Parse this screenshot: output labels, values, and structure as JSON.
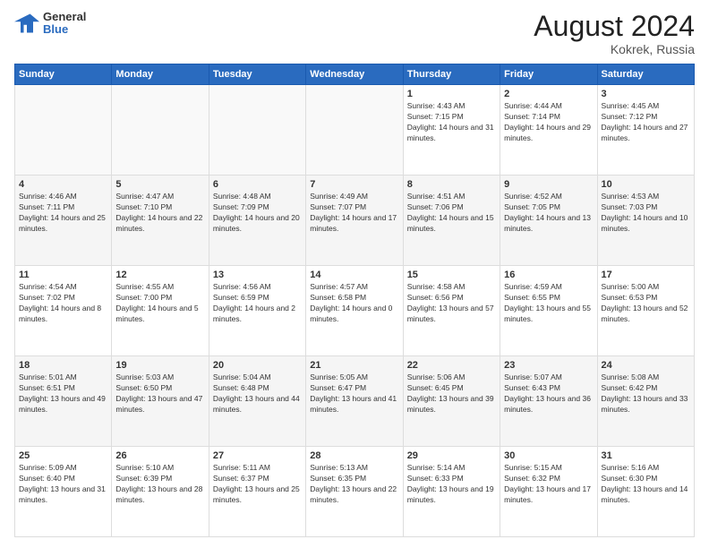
{
  "header": {
    "logo_general": "General",
    "logo_blue": "Blue",
    "main_title": "August 2024",
    "subtitle": "Kokrek, Russia"
  },
  "days_of_week": [
    "Sunday",
    "Monday",
    "Tuesday",
    "Wednesday",
    "Thursday",
    "Friday",
    "Saturday"
  ],
  "weeks": [
    [
      {
        "day": "",
        "empty": true
      },
      {
        "day": "",
        "empty": true
      },
      {
        "day": "",
        "empty": true
      },
      {
        "day": "",
        "empty": true
      },
      {
        "day": "1",
        "sunrise": "4:43 AM",
        "sunset": "7:15 PM",
        "daylight": "14 hours and 31 minutes."
      },
      {
        "day": "2",
        "sunrise": "4:44 AM",
        "sunset": "7:14 PM",
        "daylight": "14 hours and 29 minutes."
      },
      {
        "day": "3",
        "sunrise": "4:45 AM",
        "sunset": "7:12 PM",
        "daylight": "14 hours and 27 minutes."
      }
    ],
    [
      {
        "day": "4",
        "sunrise": "4:46 AM",
        "sunset": "7:11 PM",
        "daylight": "14 hours and 25 minutes."
      },
      {
        "day": "5",
        "sunrise": "4:47 AM",
        "sunset": "7:10 PM",
        "daylight": "14 hours and 22 minutes."
      },
      {
        "day": "6",
        "sunrise": "4:48 AM",
        "sunset": "7:09 PM",
        "daylight": "14 hours and 20 minutes."
      },
      {
        "day": "7",
        "sunrise": "4:49 AM",
        "sunset": "7:07 PM",
        "daylight": "14 hours and 17 minutes."
      },
      {
        "day": "8",
        "sunrise": "4:51 AM",
        "sunset": "7:06 PM",
        "daylight": "14 hours and 15 minutes."
      },
      {
        "day": "9",
        "sunrise": "4:52 AM",
        "sunset": "7:05 PM",
        "daylight": "14 hours and 13 minutes."
      },
      {
        "day": "10",
        "sunrise": "4:53 AM",
        "sunset": "7:03 PM",
        "daylight": "14 hours and 10 minutes."
      }
    ],
    [
      {
        "day": "11",
        "sunrise": "4:54 AM",
        "sunset": "7:02 PM",
        "daylight": "14 hours and 8 minutes."
      },
      {
        "day": "12",
        "sunrise": "4:55 AM",
        "sunset": "7:00 PM",
        "daylight": "14 hours and 5 minutes."
      },
      {
        "day": "13",
        "sunrise": "4:56 AM",
        "sunset": "6:59 PM",
        "daylight": "14 hours and 2 minutes."
      },
      {
        "day": "14",
        "sunrise": "4:57 AM",
        "sunset": "6:58 PM",
        "daylight": "14 hours and 0 minutes."
      },
      {
        "day": "15",
        "sunrise": "4:58 AM",
        "sunset": "6:56 PM",
        "daylight": "13 hours and 57 minutes."
      },
      {
        "day": "16",
        "sunrise": "4:59 AM",
        "sunset": "6:55 PM",
        "daylight": "13 hours and 55 minutes."
      },
      {
        "day": "17",
        "sunrise": "5:00 AM",
        "sunset": "6:53 PM",
        "daylight": "13 hours and 52 minutes."
      }
    ],
    [
      {
        "day": "18",
        "sunrise": "5:01 AM",
        "sunset": "6:51 PM",
        "daylight": "13 hours and 49 minutes."
      },
      {
        "day": "19",
        "sunrise": "5:03 AM",
        "sunset": "6:50 PM",
        "daylight": "13 hours and 47 minutes."
      },
      {
        "day": "20",
        "sunrise": "5:04 AM",
        "sunset": "6:48 PM",
        "daylight": "13 hours and 44 minutes."
      },
      {
        "day": "21",
        "sunrise": "5:05 AM",
        "sunset": "6:47 PM",
        "daylight": "13 hours and 41 minutes."
      },
      {
        "day": "22",
        "sunrise": "5:06 AM",
        "sunset": "6:45 PM",
        "daylight": "13 hours and 39 minutes."
      },
      {
        "day": "23",
        "sunrise": "5:07 AM",
        "sunset": "6:43 PM",
        "daylight": "13 hours and 36 minutes."
      },
      {
        "day": "24",
        "sunrise": "5:08 AM",
        "sunset": "6:42 PM",
        "daylight": "13 hours and 33 minutes."
      }
    ],
    [
      {
        "day": "25",
        "sunrise": "5:09 AM",
        "sunset": "6:40 PM",
        "daylight": "13 hours and 31 minutes."
      },
      {
        "day": "26",
        "sunrise": "5:10 AM",
        "sunset": "6:39 PM",
        "daylight": "13 hours and 28 minutes."
      },
      {
        "day": "27",
        "sunrise": "5:11 AM",
        "sunset": "6:37 PM",
        "daylight": "13 hours and 25 minutes."
      },
      {
        "day": "28",
        "sunrise": "5:13 AM",
        "sunset": "6:35 PM",
        "daylight": "13 hours and 22 minutes."
      },
      {
        "day": "29",
        "sunrise": "5:14 AM",
        "sunset": "6:33 PM",
        "daylight": "13 hours and 19 minutes."
      },
      {
        "day": "30",
        "sunrise": "5:15 AM",
        "sunset": "6:32 PM",
        "daylight": "13 hours and 17 minutes."
      },
      {
        "day": "31",
        "sunrise": "5:16 AM",
        "sunset": "6:30 PM",
        "daylight": "13 hours and 14 minutes."
      }
    ]
  ],
  "labels": {
    "sunrise": "Sunrise:",
    "sunset": "Sunset:",
    "daylight": "Daylight hours"
  },
  "colors": {
    "header_bg": "#2a6bbf",
    "accent": "#2a6bbf"
  }
}
